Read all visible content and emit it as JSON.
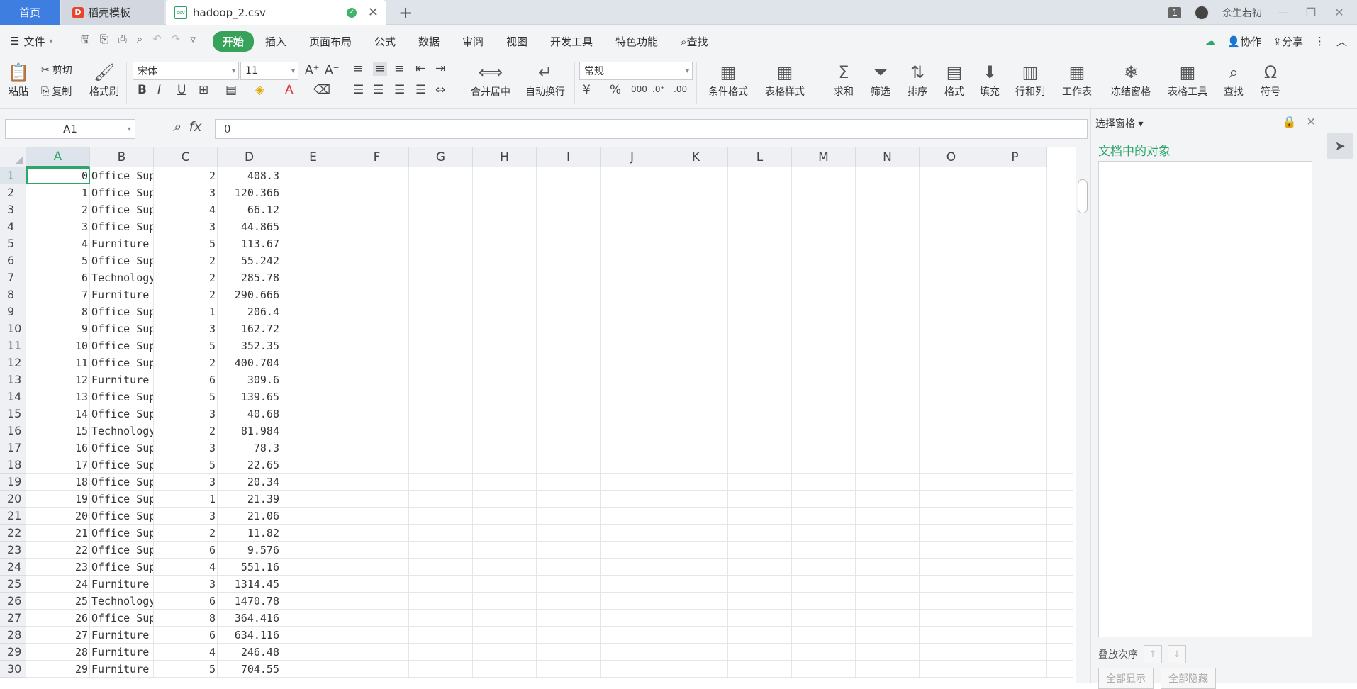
{
  "tabs": {
    "home": "首页",
    "template": "稻壳模板",
    "template_logo": "D",
    "file": "hadoop_2.csv",
    "file_icon": "csv",
    "add": "+",
    "close": "✕"
  },
  "window": {
    "badge": "1",
    "user": "余生若初",
    "min": "—",
    "restore": "❐",
    "close": "✕"
  },
  "menu": {
    "file": "文件",
    "tabs": [
      "开始",
      "插入",
      "页面布局",
      "公式",
      "数据",
      "审阅",
      "视图",
      "开发工具",
      "特色功能"
    ],
    "search": "查找",
    "collab": "协作",
    "share": "分享"
  },
  "ribbon": {
    "paste": "粘贴",
    "cut": "剪切",
    "copy": "复制",
    "format_painter": "格式刷",
    "font": "宋体",
    "size": "11",
    "merge": "合并居中",
    "wrap": "自动换行",
    "number_format": "常规",
    "cond_format": "条件格式",
    "table_style": "表格样式",
    "sum": "求和",
    "filter": "筛选",
    "sort": "排序",
    "format": "格式",
    "fill": "填充",
    "rowcol": "行和列",
    "sheet": "工作表",
    "freeze": "冻结窗格",
    "table_tools": "表格工具",
    "find": "查找",
    "symbol": "符号"
  },
  "formula": {
    "name_box": "A1",
    "fx": "fx",
    "value": "0"
  },
  "columns": [
    "A",
    "B",
    "C",
    "D",
    "E",
    "F",
    "G",
    "H",
    "I",
    "J",
    "K",
    "L",
    "M",
    "N",
    "O",
    "P"
  ],
  "rows": [
    {
      "n": "1",
      "a": "0",
      "b": "Office Sup",
      "c": "2",
      "d": "408.3"
    },
    {
      "n": "2",
      "a": "1",
      "b": "Office Sup",
      "c": "3",
      "d": "120.366"
    },
    {
      "n": "3",
      "a": "2",
      "b": "Office Sup",
      "c": "4",
      "d": "66.12"
    },
    {
      "n": "4",
      "a": "3",
      "b": "Office Sup",
      "c": "3",
      "d": "44.865"
    },
    {
      "n": "5",
      "a": "4",
      "b": "Furniture",
      "c": "5",
      "d": "113.67"
    },
    {
      "n": "6",
      "a": "5",
      "b": "Office Sup",
      "c": "2",
      "d": "55.242"
    },
    {
      "n": "7",
      "a": "6",
      "b": "Technology",
      "c": "2",
      "d": "285.78"
    },
    {
      "n": "8",
      "a": "7",
      "b": "Furniture",
      "c": "2",
      "d": "290.666"
    },
    {
      "n": "9",
      "a": "8",
      "b": "Office Sup",
      "c": "1",
      "d": "206.4"
    },
    {
      "n": "10",
      "a": "9",
      "b": "Office Sup",
      "c": "3",
      "d": "162.72"
    },
    {
      "n": "11",
      "a": "10",
      "b": "Office Sup",
      "c": "5",
      "d": "352.35"
    },
    {
      "n": "12",
      "a": "11",
      "b": "Office Sup",
      "c": "2",
      "d": "400.704"
    },
    {
      "n": "13",
      "a": "12",
      "b": "Furniture",
      "c": "6",
      "d": "309.6"
    },
    {
      "n": "14",
      "a": "13",
      "b": "Office Sup",
      "c": "5",
      "d": "139.65"
    },
    {
      "n": "15",
      "a": "14",
      "b": "Office Sup",
      "c": "3",
      "d": "40.68"
    },
    {
      "n": "16",
      "a": "15",
      "b": "Technology",
      "c": "2",
      "d": "81.984"
    },
    {
      "n": "17",
      "a": "16",
      "b": "Office Sup",
      "c": "3",
      "d": "78.3"
    },
    {
      "n": "18",
      "a": "17",
      "b": "Office Sup",
      "c": "5",
      "d": "22.65"
    },
    {
      "n": "19",
      "a": "18",
      "b": "Office Sup",
      "c": "3",
      "d": "20.34"
    },
    {
      "n": "20",
      "a": "19",
      "b": "Office Sup",
      "c": "1",
      "d": "21.39"
    },
    {
      "n": "21",
      "a": "20",
      "b": "Office Sup",
      "c": "3",
      "d": "21.06"
    },
    {
      "n": "22",
      "a": "21",
      "b": "Office Sup",
      "c": "2",
      "d": "11.82"
    },
    {
      "n": "23",
      "a": "22",
      "b": "Office Sup",
      "c": "6",
      "d": "9.576"
    },
    {
      "n": "24",
      "a": "23",
      "b": "Office Sup",
      "c": "4",
      "d": "551.16"
    },
    {
      "n": "25",
      "a": "24",
      "b": "Furniture",
      "c": "3",
      "d": "1314.45"
    },
    {
      "n": "26",
      "a": "25",
      "b": "Technology",
      "c": "6",
      "d": "1470.78"
    },
    {
      "n": "27",
      "a": "26",
      "b": "Office Sup",
      "c": "8",
      "d": "364.416"
    },
    {
      "n": "28",
      "a": "27",
      "b": "Furniture",
      "c": "6",
      "d": "634.116"
    },
    {
      "n": "29",
      "a": "28",
      "b": "Furniture",
      "c": "4",
      "d": "246.48"
    },
    {
      "n": "30",
      "a": "29",
      "b": "Furniture",
      "c": "5",
      "d": "704.55"
    }
  ],
  "panel": {
    "title": "选择窗格",
    "subtitle": "文档中的对象",
    "order": "叠放次序",
    "show_all": "全部显示",
    "hide_all": "全部隐藏"
  },
  "colors": {
    "accent": "#2ea66a",
    "home_tab": "#3d7ee0"
  }
}
